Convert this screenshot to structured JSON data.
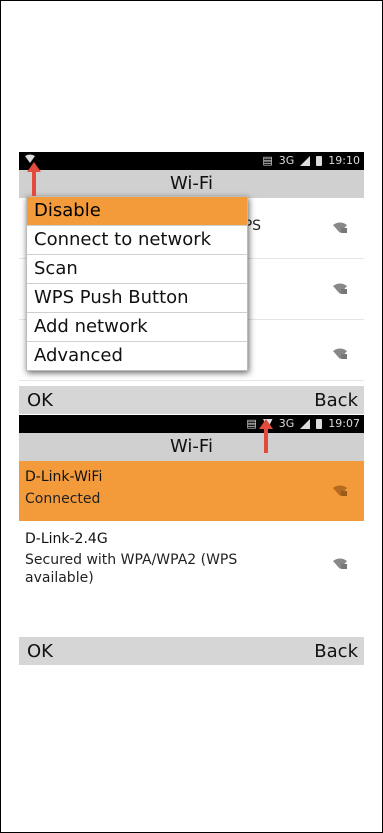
{
  "screen1": {
    "status": {
      "time": "19:10",
      "network": "3G"
    },
    "title": "Wi-Fi",
    "menu": {
      "items": [
        {
          "label": "Disable",
          "active": true
        },
        {
          "label": "Connect to network",
          "active": false
        },
        {
          "label": "Scan",
          "active": false
        },
        {
          "label": "WPS Push Button",
          "active": false
        },
        {
          "label": "Add network",
          "active": false
        },
        {
          "label": "Advanced",
          "active": false
        }
      ]
    },
    "behind_text": "/PS",
    "softkeys": {
      "ok": "OK",
      "back": "Back"
    }
  },
  "screen2": {
    "status": {
      "time": "19:07",
      "network": "3G"
    },
    "title": "Wi-Fi",
    "networks": [
      {
        "ssid": "D-Link-WiFi",
        "status": "Connected",
        "highlight": true
      },
      {
        "ssid": "D-Link-2.4G",
        "status": "Secured with WPA/WPA2 (WPS available)",
        "highlight": false
      }
    ],
    "softkeys": {
      "ok": "OK",
      "back": "Back"
    }
  },
  "colors": {
    "accent": "#f39a3b",
    "arrow": "#e24b3b",
    "bar": "#d0d0d0"
  }
}
